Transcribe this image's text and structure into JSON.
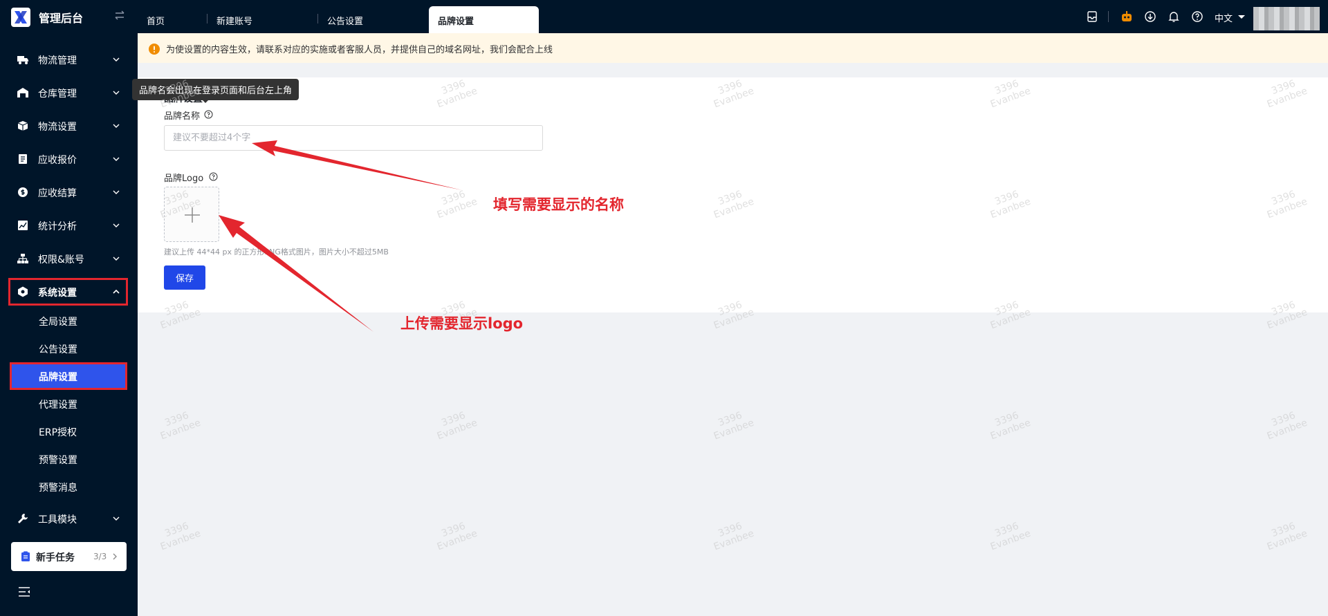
{
  "header": {
    "app_title": "管理后台",
    "tabs": [
      {
        "label": "首页",
        "active": false
      },
      {
        "label": "新建账号",
        "active": false
      },
      {
        "label": "公告设置",
        "active": false
      },
      {
        "label": "品牌设置",
        "active": true
      }
    ],
    "language": "中文",
    "icons": [
      "inbox-icon",
      "robot-icon",
      "download-icon",
      "bell-icon",
      "help-icon"
    ],
    "accent_color": "#f08c00"
  },
  "sidebar": {
    "menu": [
      {
        "label": "物流管理",
        "icon": "truck-icon"
      },
      {
        "label": "仓库管理",
        "icon": "warehouse-icon"
      },
      {
        "label": "物流设置",
        "icon": "package-icon"
      },
      {
        "label": "应收报价",
        "icon": "document-icon"
      },
      {
        "label": "应收结算",
        "icon": "dollar-icon"
      },
      {
        "label": "统计分析",
        "icon": "chart-icon"
      },
      {
        "label": "权限&账号",
        "icon": "org-icon"
      },
      {
        "label": "系统设置",
        "icon": "hexagon-gear-icon",
        "open": true
      }
    ],
    "submenu": [
      {
        "label": "全局设置",
        "active": false
      },
      {
        "label": "公告设置",
        "active": false
      },
      {
        "label": "品牌设置",
        "active": true
      },
      {
        "label": "代理设置",
        "active": false
      },
      {
        "label": "ERP授权",
        "active": false
      },
      {
        "label": "预警设置",
        "active": false
      },
      {
        "label": "预警消息",
        "active": false
      }
    ],
    "tools": {
      "label": "工具模块",
      "icon": "wrench-icon"
    },
    "task_card": {
      "label": "新手任务",
      "count": "3/3"
    }
  },
  "main": {
    "notice": "为使设置的内容生效，请联系对应的实施或者客服人员，并提供自己的域名网址，我们会配合上线",
    "section_title": "品牌设置",
    "tooltip": "品牌名会出现在登录页面和后台左上角",
    "brand_name": {
      "label": "品牌名称",
      "value": "",
      "placeholder": "建议不要超过4个字"
    },
    "brand_logo": {
      "label": "品牌Logo",
      "hint": "建议上传 44*44 px 的正方形PNG格式图片，图片大小不超过5MB"
    },
    "save_label": "保存"
  },
  "annotations": {
    "name_note": "填写需要显示的名称",
    "logo_note": "上传需要显示logo",
    "color": "#e3262e"
  },
  "watermark": {
    "line1": "3396",
    "line2": "Evanbee"
  }
}
